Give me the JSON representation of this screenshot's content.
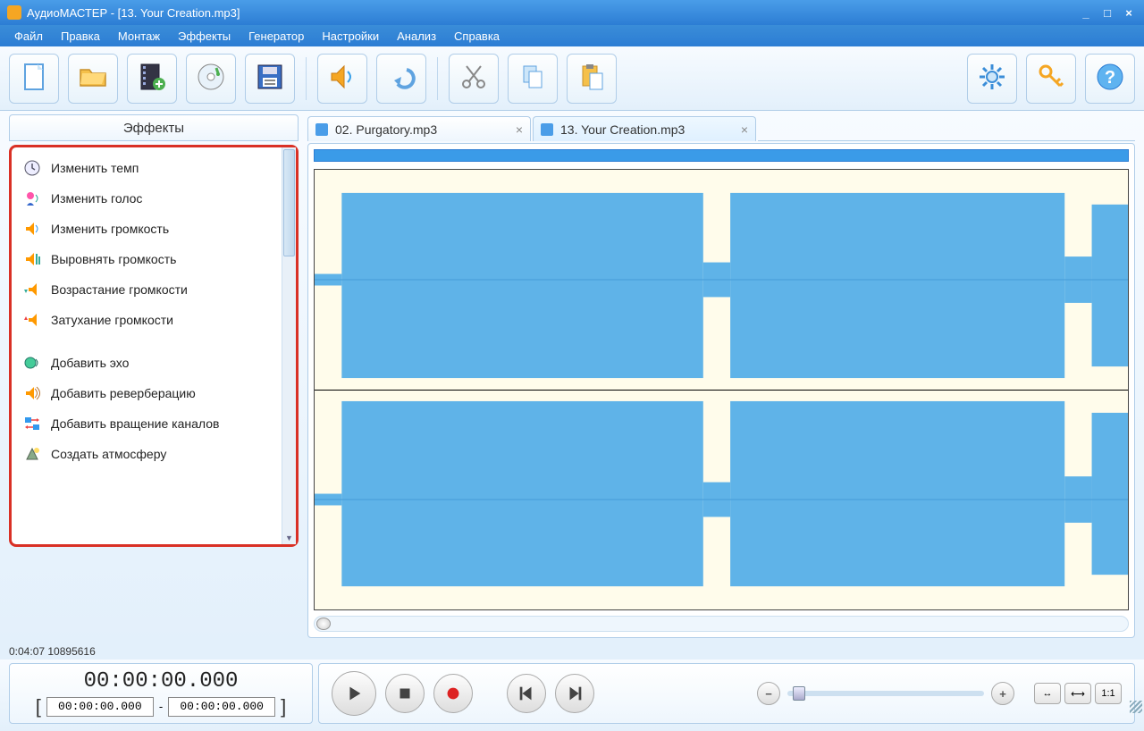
{
  "window": {
    "title": "АудиоМАСТЕР - [13. Your Creation.mp3]"
  },
  "menu": {
    "items": [
      "Файл",
      "Правка",
      "Монтаж",
      "Эффекты",
      "Генератор",
      "Настройки",
      "Анализ",
      "Справка"
    ]
  },
  "toolbar": {
    "buttons": [
      "new-file",
      "open-file",
      "import-video",
      "burn-cd",
      "save",
      "volume-effect",
      "undo",
      "cut",
      "copy",
      "paste"
    ],
    "right_buttons": [
      "settings",
      "register-key",
      "help"
    ]
  },
  "effects": {
    "header": "Эффекты",
    "items": [
      {
        "icon": "clock-icon",
        "label": "Изменить темп"
      },
      {
        "icon": "person-voice-icon",
        "label": "Изменить голос"
      },
      {
        "icon": "speaker-volume-icon",
        "label": "Изменить громкость"
      },
      {
        "icon": "speaker-eq-icon",
        "label": "Выровнять громкость"
      },
      {
        "icon": "volume-up-icon",
        "label": "Возрастание громкости"
      },
      {
        "icon": "volume-down-icon",
        "label": "Затухание громкости"
      }
    ],
    "items2": [
      {
        "icon": "echo-icon",
        "label": "Добавить эхо"
      },
      {
        "icon": "reverb-icon",
        "label": "Добавить реверберацию"
      },
      {
        "icon": "channel-rotate-icon",
        "label": "Добавить вращение каналов"
      },
      {
        "icon": "atmosphere-icon",
        "label": "Создать атмосферу"
      }
    ]
  },
  "tabs": [
    {
      "label": "02. Purgatory.mp3",
      "active": false
    },
    {
      "label": "13. Your Creation.mp3",
      "active": true
    }
  ],
  "status": {
    "text": "0:04:07 10895616"
  },
  "time": {
    "big": "00:00:00.000",
    "from": "00:00:00.000",
    "to": "00:00:00.000",
    "sep": "-"
  },
  "fit_labels": [
    "↔",
    "⟷",
    "1:1"
  ]
}
